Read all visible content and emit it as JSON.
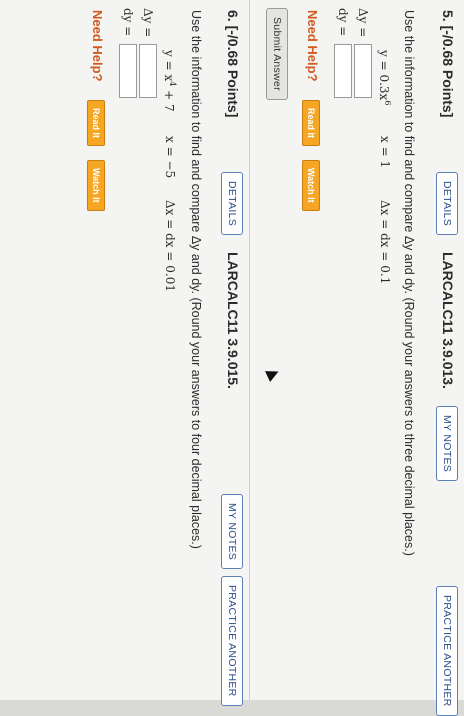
{
  "q1": {
    "number": "5. [-/0.68 Points]",
    "details": "DETAILS",
    "code": "LARCALC11 3.9.013.",
    "my_notes": "MY NOTES",
    "practice": "PRACTICE ANOTHER",
    "instruction": "Use the information to find and compare Δy and dy. (Round your answers to three decimal places.)",
    "function": "y = 0.3x",
    "exponent": "6",
    "x_value": "x = 1",
    "delta": "Δx = dx = 0.1",
    "dy_delta_label": "Δy =",
    "dy_label": "dy =",
    "need_help": "Need Help?",
    "read_it": "Read It",
    "watch_it": "Watch It",
    "submit": "Submit Answer"
  },
  "q2": {
    "number": "6. [-/0.68 Points]",
    "details": "DETAILS",
    "code": "LARCALC11 3.9.015.",
    "my_notes": "MY NOTES",
    "practice": "PRACTICE ANOTHER",
    "instruction": "Use the information to find and compare Δy and dy. (Round your answers to four decimal places.)",
    "function": "y = x",
    "exponent": "4",
    "function_tail": " + 7",
    "x_value": "x = −5",
    "delta": "Δx = dx = 0.01",
    "dy_delta_label": "Δy =",
    "dy_label": "dy =",
    "need_help": "Need Help?",
    "read_it": "Read It",
    "watch_it": "Watch It"
  },
  "colors": {
    "accent": "#5d80b8",
    "help": "#d2591c",
    "help_button": "#f6a623"
  }
}
